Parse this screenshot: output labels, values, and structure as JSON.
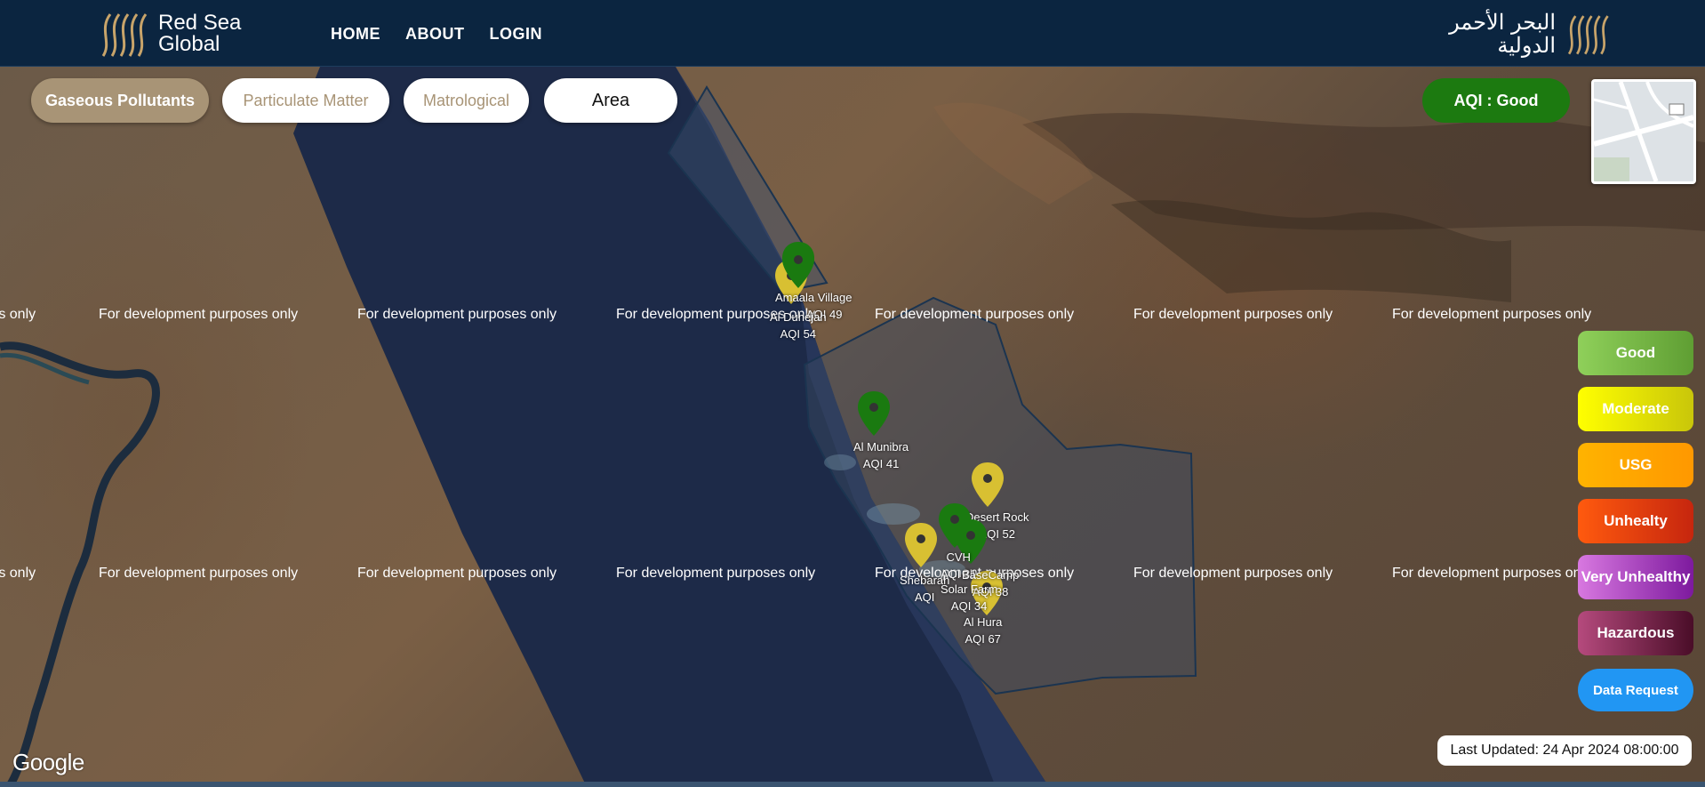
{
  "nav": {
    "brand_line1": "Red Sea",
    "brand_line2": "Global",
    "brand_ar_line1": "البحر الأحمر",
    "brand_ar_line2": "الدولية",
    "links": [
      "HOME",
      "ABOUT",
      "LOGIN"
    ]
  },
  "tabs": {
    "gaseous": "Gaseous Pollutants",
    "particulate": "Particulate Matter",
    "matrological": "Matrological",
    "area": "Area"
  },
  "aqi_status": "AQI : Good",
  "watermark_text": "For development purposes only",
  "legend": [
    {
      "label": "Good",
      "color": "#7cc24a"
    },
    {
      "label": "Moderate",
      "color": "#f2ef0a"
    },
    {
      "label": "USG",
      "color": "#ffa500"
    },
    {
      "label": "Unhealty",
      "color": "#e8390e"
    },
    {
      "label": "Very Unhealthy",
      "color": "#a02fbf"
    },
    {
      "label": "Hazardous",
      "color": "#7a1a47"
    }
  ],
  "data_request": "Data Request",
  "last_updated": "Last Updated: 24 Apr 2024 08:00:00",
  "google_logo": "Google",
  "stations": [
    {
      "name": "Amaala Village",
      "aqi": "AQI 49",
      "color": "#1a7a10"
    },
    {
      "name": "Al Duhejah",
      "aqi": "AQI 54",
      "color": "#d8c032"
    },
    {
      "name": "Al Munibra",
      "aqi": "AQI 41",
      "color": "#1a7a10"
    },
    {
      "name": "Desert Rock",
      "aqi": "AQI 52",
      "color": "#d8c032"
    },
    {
      "name": "CVH",
      "aqi": "AQI 31",
      "color": "#1a7a10"
    },
    {
      "name": "Shebarah",
      "aqi": "AQI",
      "color": "#d8c032"
    },
    {
      "name": "BaseCamp",
      "aqi": "AQI 38",
      "color": "#1a7a10"
    },
    {
      "name": "Solar Farm",
      "aqi": "AQI 34",
      "color": "#1a7a10"
    },
    {
      "name": "Al Hura",
      "aqi": "AQI 67",
      "color": "#d8c032"
    }
  ]
}
